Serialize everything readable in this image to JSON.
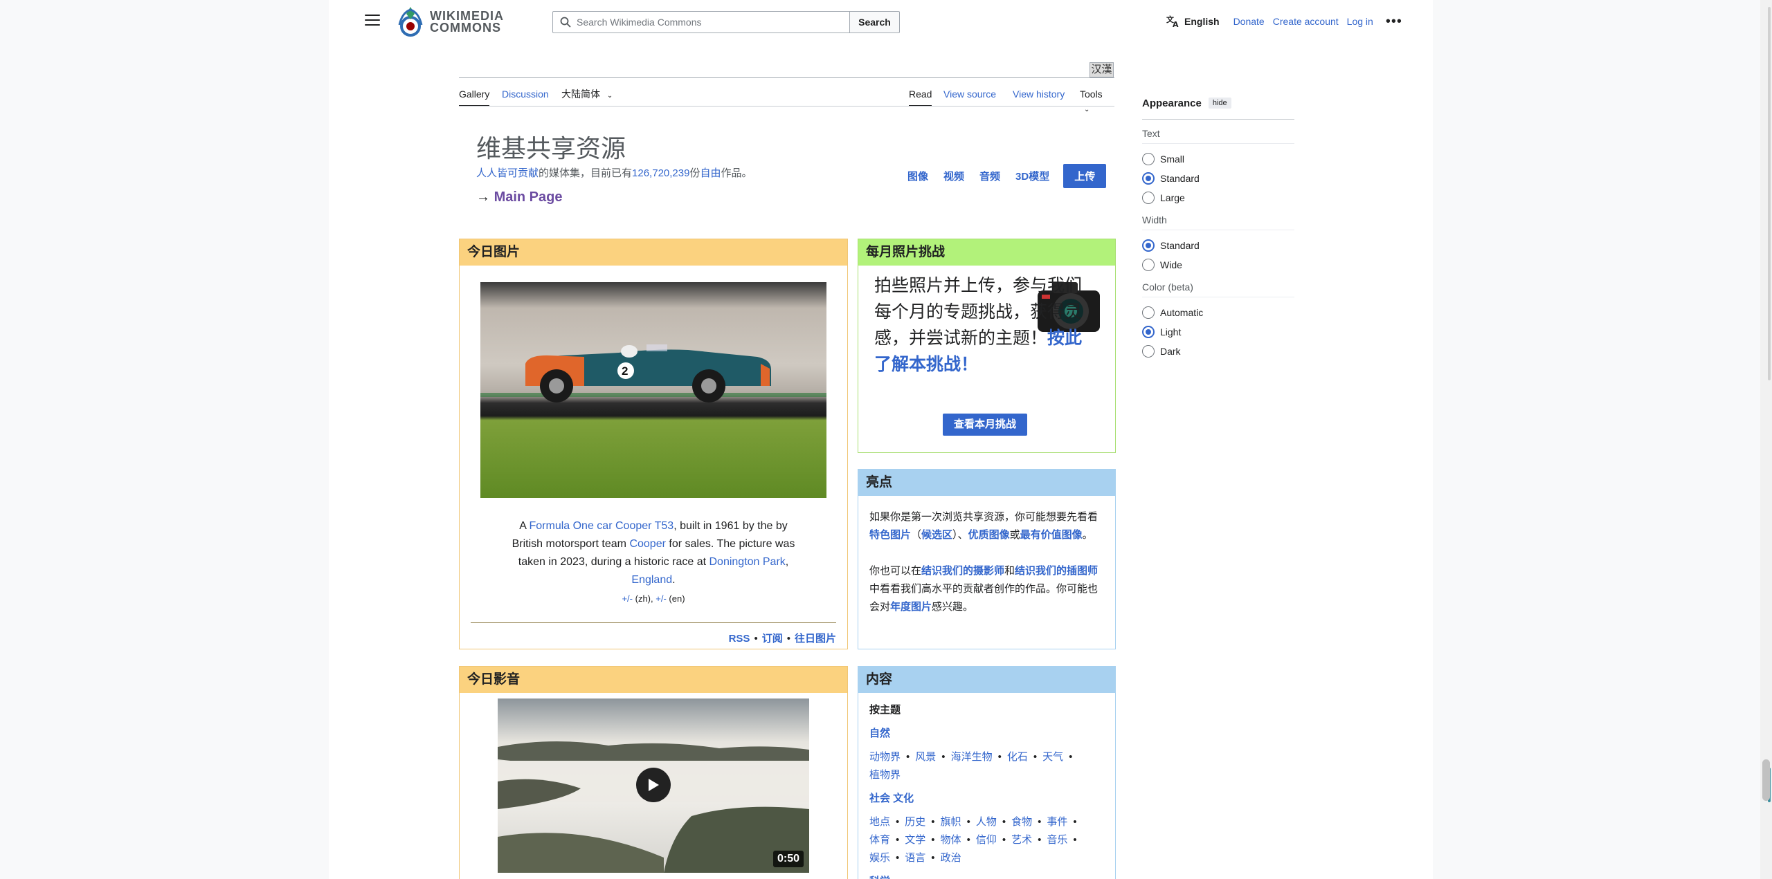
{
  "header": {
    "logo_line1": "WIKIMEDIA",
    "logo_line2": "COMMONS",
    "search_placeholder": "Search Wikimedia Commons",
    "search_button": "Search",
    "language": "English",
    "donate": "Donate",
    "create_account": "Create account",
    "log_in": "Log in",
    "more": "•••"
  },
  "variant_box": "汉漢",
  "tabs": {
    "gallery": "Gallery",
    "discussion": "Discussion",
    "variant": "大陆简体",
    "read": "Read",
    "view_source": "View source",
    "view_history": "View history",
    "tools": "Tools"
  },
  "page": {
    "title": "维基共享资源",
    "subtitle_link1": "人人皆可贡献",
    "subtitle_text1": "的媒体集，目前已有",
    "subtitle_count": "126,720,239",
    "subtitle_text2": "份",
    "subtitle_link2": "自由",
    "subtitle_text3": "作品。",
    "main_page_arrow": "→ ",
    "main_page": "Main Page",
    "media_links": [
      "图像",
      "视频",
      "音频",
      "3D模型"
    ],
    "upload": "上传"
  },
  "potd": {
    "heading": "今日图片",
    "caption_a": "A ",
    "caption_link1": "Formula One car",
    "caption_link2": "Cooper T53",
    "caption_b": ", built in 1961 by the by British motorsport team ",
    "caption_link3": "Cooper",
    "caption_c": " for sales. The picture was taken in 2023, during a historic race at ",
    "caption_link4": "Donington Park",
    "caption_d": ", ",
    "caption_link5": "England",
    "caption_e": ".",
    "small_1": "+/-",
    "small_2": " (zh), ",
    "small_3": "+/-",
    "small_4": " (en)",
    "footer": [
      "RSS",
      "订阅",
      "往日图片"
    ],
    "car_number": "2"
  },
  "challenge": {
    "heading": "每月照片挑战",
    "text": "拍些照片并上传，参与我们每个月的专题挑战，获得灵感，并尝试新的主题！",
    "link": "按此了解本挑战！",
    "button": "查看本月挑战"
  },
  "highlights": {
    "heading": "亮点",
    "p1_a": "如果你是第一次浏览共享资源，你可能想要先看看",
    "p1_link1": "特色图片",
    "p1_b": "（",
    "p1_link2": "候选区",
    "p1_c": "）、",
    "p1_link3": "优质图像",
    "p1_d": "或",
    "p1_link4": "最有价值图像",
    "p1_e": "。",
    "p2_a": "你也可以在",
    "p2_link1": "结识我们的摄影师",
    "p2_b": "和",
    "p2_link2": "结识我们的插图师",
    "p2_c": "中看看我们高水平的贡献者创作的作品。你可能也会对",
    "p2_link3": "年度图片",
    "p2_d": "感兴趣。"
  },
  "motd": {
    "heading": "今日影音",
    "duration": "0:50"
  },
  "contents": {
    "heading": "内容",
    "by_topic": "按主题",
    "nature": "自然",
    "nature_items": [
      "动物界",
      "风景",
      "海洋生物",
      "化石",
      "天气",
      "植物界"
    ],
    "society": "社会  文化",
    "society_items": [
      "地点",
      "历史",
      "旗帜",
      "人物",
      "食物",
      "事件",
      "体育",
      "文学",
      "物体",
      "信仰",
      "艺术",
      "音乐",
      "娱乐",
      "语言",
      "政治"
    ],
    "science": "科学"
  },
  "appearance": {
    "title": "Appearance",
    "hide": "hide",
    "text_label": "Text",
    "text_options": [
      "Small",
      "Standard",
      "Large"
    ],
    "text_selected": "Standard",
    "width_label": "Width",
    "width_options": [
      "Standard",
      "Wide"
    ],
    "width_selected": "Standard",
    "color_label": "Color (beta)",
    "color_options": [
      "Automatic",
      "Light",
      "Dark"
    ],
    "color_selected": "Light"
  }
}
